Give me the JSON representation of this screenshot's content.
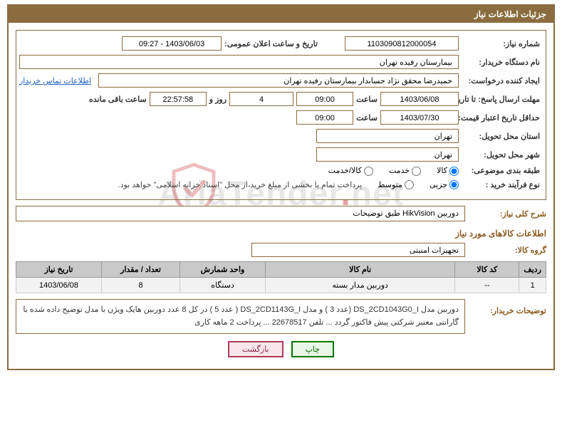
{
  "header": {
    "title": "جزئیات اطلاعات نیاز"
  },
  "watermark": {
    "text_part1": "AriaTender",
    "text_part2": "net",
    "sep": "."
  },
  "fields": {
    "need_no_label": "شماره نیاز:",
    "need_no": "1103090812000054",
    "announce_label": "تاریخ و ساعت اعلان عمومی:",
    "announce_value": "1403/06/03 - 09:27",
    "buyer_org_label": "نام دستگاه خریدار:",
    "buyer_org": "بیمارستان رفیده تهران",
    "requester_label": "ایجاد کننده درخواست:",
    "requester": "حمیدرضا  محقق نژاد حسابدار بیمارستان رفیده تهران",
    "contact_link": "اطلاعات تماس خریدار",
    "reply_deadline_label": "مهلت ارسال پاسخ: تا تاریخ:",
    "reply_date": "1403/06/08",
    "time_label": "ساعت",
    "reply_time": "09:00",
    "days_value": "4",
    "days_and": "روز و",
    "countdown": "22:57:58",
    "remaining": "ساعت باقی مانده",
    "validity_label": "حداقل تاریخ اعتبار قیمت: تا تاریخ:",
    "validity_date": "1403/07/30",
    "validity_time": "09:00",
    "province_label": "استان محل تحویل:",
    "province": "تهران",
    "city_label": "شهر محل تحویل:",
    "city": "تهران",
    "category_label": "طبقه بندی موضوعی:",
    "cat_goods": "کالا",
    "cat_service": "خدمت",
    "cat_goods_service": "کالا/خدمت",
    "process_label": "نوع فرآیند خرید :",
    "proc_minor": "جزیی",
    "proc_medium": "متوسط",
    "process_note": "پرداخت تمام یا بخشی از مبلغ خرید،از محل \"اسناد خزانه اسلامی\" خواهد بود.",
    "summary_label": "شرح کلی نیاز:",
    "summary": "دوربین HikVision طبق توضیحات",
    "goods_section": "اطلاعات کالاهای مورد نیاز",
    "group_label": "گروه کالا:",
    "group": "تجهیزات امنیتی",
    "buyer_desc_label": "توضیحات خریدار:",
    "buyer_desc": "دوربین مدل DS_2CD1043G0_I (عدد 3 )  و مدل DS_2CD1143G_I ( عدد 5 )  در کل 8 عدد دوربین هایک ویژن با مدل توضیح داده شده با گارانتی معتبر شرکتی پیش فاکتور گردد ... تلفن 22678517 ... پرداخت 2 ماهه کاری"
  },
  "table": {
    "headers": {
      "row": "ردیف",
      "code": "کد کالا",
      "name": "نام کالا",
      "unit": "واحد شمارش",
      "qty": "تعداد / مقدار",
      "date": "تاریخ نیاز"
    },
    "rows": [
      {
        "row": "1",
        "code": "--",
        "name": "دوربین مدار بسته",
        "unit": "دستگاه",
        "qty": "8",
        "date": "1403/06/08"
      }
    ]
  },
  "buttons": {
    "print": "چاپ",
    "back": "بازگشت"
  }
}
